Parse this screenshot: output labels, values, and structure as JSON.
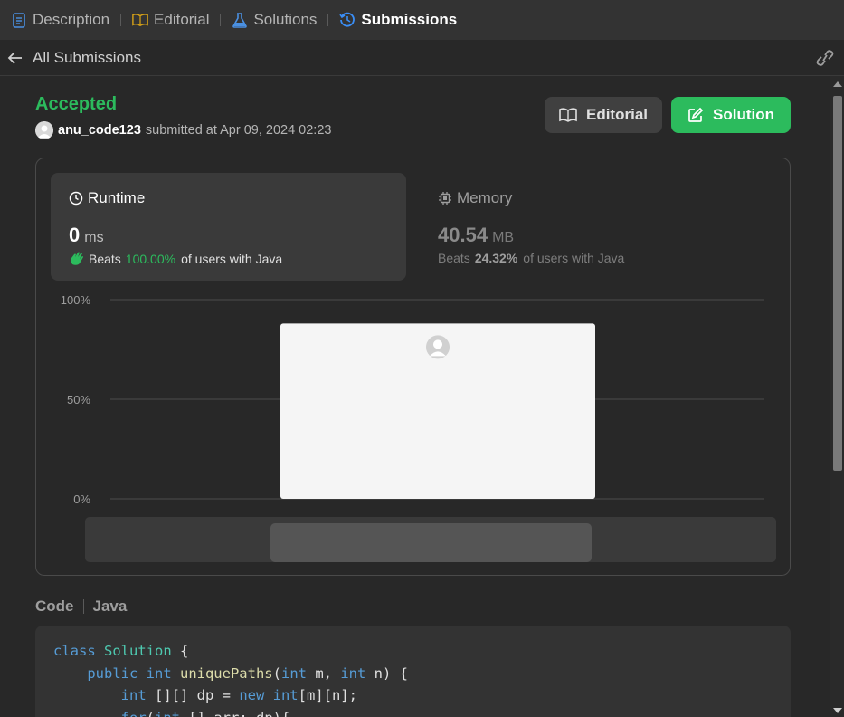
{
  "tabs": [
    {
      "label": "Description",
      "icon": "description-icon",
      "color": "#4a90e2"
    },
    {
      "label": "Editorial",
      "icon": "book-icon",
      "color": "#d4a017"
    },
    {
      "label": "Solutions",
      "icon": "flask-icon",
      "color": "#4a90e2"
    },
    {
      "label": "Submissions",
      "icon": "history-icon",
      "color": "#3a8ef6",
      "active": true
    }
  ],
  "subheader": {
    "back_label": "All Submissions"
  },
  "submission": {
    "status": "Accepted",
    "user": "anu_code123",
    "submitted_text": "submitted at Apr 09, 2024 02:23"
  },
  "buttons": {
    "editorial": "Editorial",
    "solution": "Solution"
  },
  "runtime": {
    "title": "Runtime",
    "value": "0",
    "unit": "ms",
    "beats_label": "Beats",
    "beats_pct": "100.00%",
    "beats_suffix": "of users with Java"
  },
  "memory": {
    "title": "Memory",
    "value": "40.54",
    "unit": "MB",
    "beats_label": "Beats",
    "beats_pct": "24.32%",
    "beats_suffix": "of users with Java"
  },
  "chart_data": {
    "type": "bar",
    "y_ticks": [
      "100%",
      "50%",
      "0%"
    ],
    "ylim": [
      0,
      100
    ],
    "values": [
      88
    ],
    "grid": true
  },
  "code": {
    "label": "Code",
    "language": "Java",
    "lines": [
      [
        {
          "t": "class ",
          "c": "kw"
        },
        {
          "t": "Solution",
          "c": "cls"
        },
        {
          "t": " {",
          "c": ""
        }
      ],
      [
        {
          "t": "    public ",
          "c": "kw"
        },
        {
          "t": "int ",
          "c": "kw"
        },
        {
          "t": "uniquePaths",
          "c": "fn"
        },
        {
          "t": "(",
          "c": ""
        },
        {
          "t": "int",
          "c": "kw"
        },
        {
          "t": " m, ",
          "c": ""
        },
        {
          "t": "int",
          "c": "kw"
        },
        {
          "t": " n) {",
          "c": ""
        }
      ],
      [
        {
          "t": "        int ",
          "c": "kw"
        },
        {
          "t": "[][] dp = ",
          "c": ""
        },
        {
          "t": "new ",
          "c": "kw"
        },
        {
          "t": "int",
          "c": "kw"
        },
        {
          "t": "[m][n];",
          "c": ""
        }
      ],
      [
        {
          "t": "        for",
          "c": "kw"
        },
        {
          "t": "(",
          "c": ""
        },
        {
          "t": "int",
          "c": "kw"
        },
        {
          "t": " [] arr: dp){",
          "c": ""
        }
      ]
    ]
  }
}
